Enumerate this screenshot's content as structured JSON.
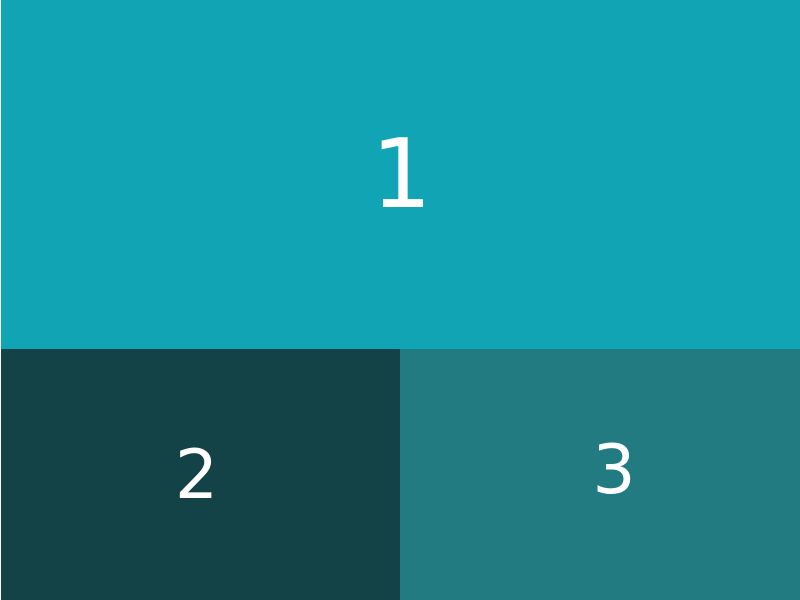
{
  "panels": [
    {
      "label": "1",
      "color": "#11a4b4"
    },
    {
      "label": "2",
      "color": "#134247"
    },
    {
      "label": "3",
      "color": "#217b81"
    }
  ]
}
